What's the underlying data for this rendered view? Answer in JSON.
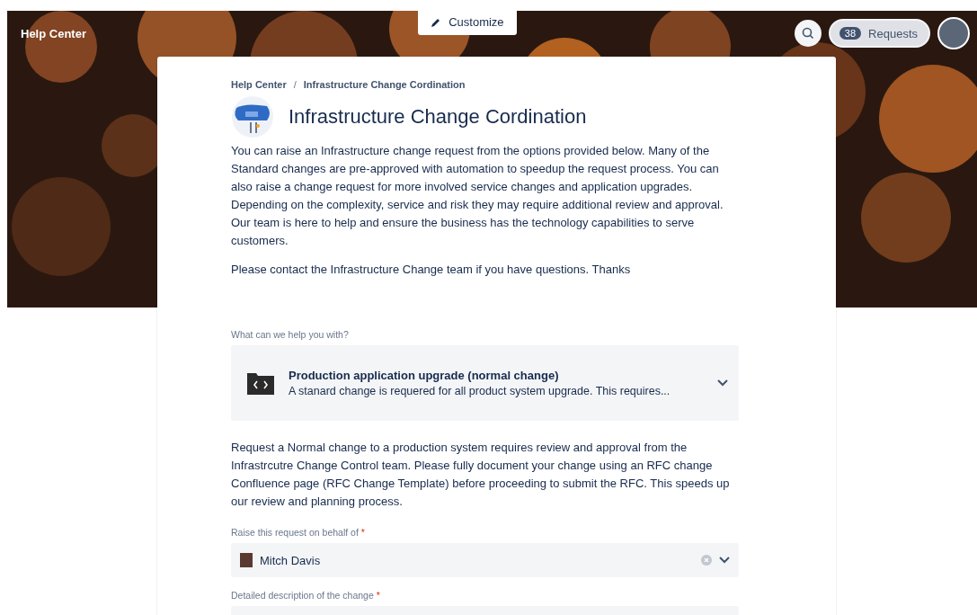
{
  "header": {
    "title": "Help Center",
    "customize": "Customize",
    "requests_count": "38",
    "requests_label": "Requests"
  },
  "breadcrumbs": [
    "Help Center",
    "Infrastructure Change Cordination"
  ],
  "breadcrumb_separator": "/",
  "title": "Infrastructure Change Cordination",
  "description": [
    "You can raise an Infrastructure change request from the options provided below. Many of the Standard changes are pre-approved with automation to speedup the request process. You can also raise a change request for more involved service changes and application upgrades. Depending on the complexity, service and risk they may require additional review and approval. Our team is here to help and ensure the business has the technology capabilities to serve customers.",
    "Please contact the Infrastructure Change team if you have questions. Thanks"
  ],
  "request_type": {
    "label": "What can we help you with?",
    "title": "Production application upgrade (normal change)",
    "summary": "A stanard change is requered for all product system upgrade. This requires..."
  },
  "info": "Request a Normal change to a production system requires review and approval from the Infrastrcutre Change Control team. Please fully document your change using an RFC change Confluence page (RFC Change Template) before proceeding to submit the RFC. This speeds up our review and planning process.",
  "fields": [
    {
      "kind": "user-select",
      "label": "Raise this request on behalf of",
      "required_mark": "*",
      "value": "Mitch Davis"
    },
    {
      "kind": "textarea",
      "label": "Detailed description of the change",
      "required_mark": "*"
    }
  ]
}
